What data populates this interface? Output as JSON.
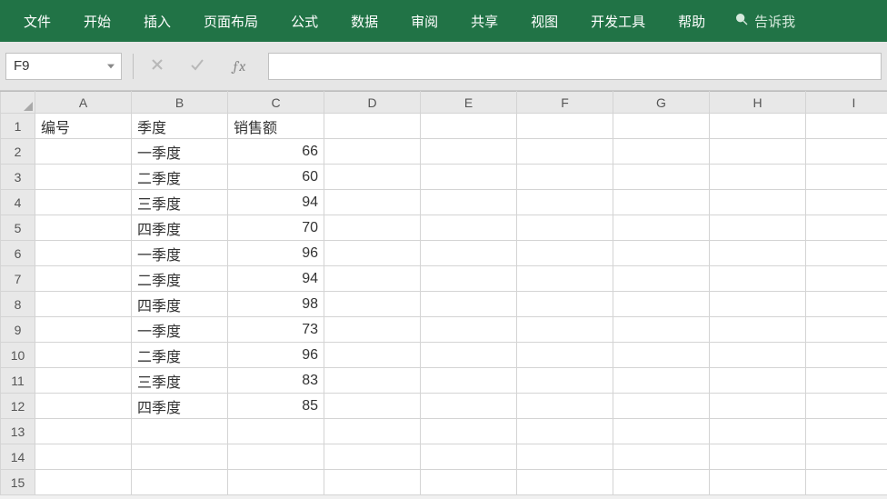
{
  "menu": {
    "items": [
      "文件",
      "开始",
      "插入",
      "页面布局",
      "公式",
      "数据",
      "审阅",
      "共享",
      "视图",
      "开发工具",
      "帮助"
    ],
    "tell_me": "告诉我"
  },
  "fx": {
    "namebox": "F9",
    "formula": ""
  },
  "grid": {
    "columns": [
      "A",
      "B",
      "C",
      "D",
      "E",
      "F",
      "G",
      "H",
      "I"
    ],
    "rows": [
      1,
      2,
      3,
      4,
      5,
      6,
      7,
      8,
      9,
      10,
      11,
      12,
      13,
      14,
      15
    ],
    "data": {
      "1": {
        "A": "编号",
        "B": "季度",
        "C": "销售额"
      },
      "2": {
        "B": "一季度",
        "C": "66"
      },
      "3": {
        "B": "二季度",
        "C": "60"
      },
      "4": {
        "B": "三季度",
        "C": "94"
      },
      "5": {
        "B": "四季度",
        "C": "70"
      },
      "6": {
        "B": "一季度",
        "C": "96"
      },
      "7": {
        "B": "二季度",
        "C": "94"
      },
      "8": {
        "B": "四季度",
        "C": "98"
      },
      "9": {
        "B": "一季度",
        "C": "73"
      },
      "10": {
        "B": "二季度",
        "C": "96"
      },
      "11": {
        "B": "三季度",
        "C": "83"
      },
      "12": {
        "B": "四季度",
        "C": "85"
      }
    }
  },
  "chart_data": {
    "type": "table",
    "title": "",
    "columns": [
      "编号",
      "季度",
      "销售额"
    ],
    "rows": [
      {
        "编号": "",
        "季度": "一季度",
        "销售额": 66
      },
      {
        "编号": "",
        "季度": "二季度",
        "销售额": 60
      },
      {
        "编号": "",
        "季度": "三季度",
        "销售额": 94
      },
      {
        "编号": "",
        "季度": "四季度",
        "销售额": 70
      },
      {
        "编号": "",
        "季度": "一季度",
        "销售额": 96
      },
      {
        "编号": "",
        "季度": "二季度",
        "销售额": 94
      },
      {
        "编号": "",
        "季度": "四季度",
        "销售额": 98
      },
      {
        "编号": "",
        "季度": "一季度",
        "销售额": 73
      },
      {
        "编号": "",
        "季度": "二季度",
        "销售额": 96
      },
      {
        "编号": "",
        "季度": "三季度",
        "销售额": 83
      },
      {
        "编号": "",
        "季度": "四季度",
        "销售额": 85
      }
    ]
  }
}
